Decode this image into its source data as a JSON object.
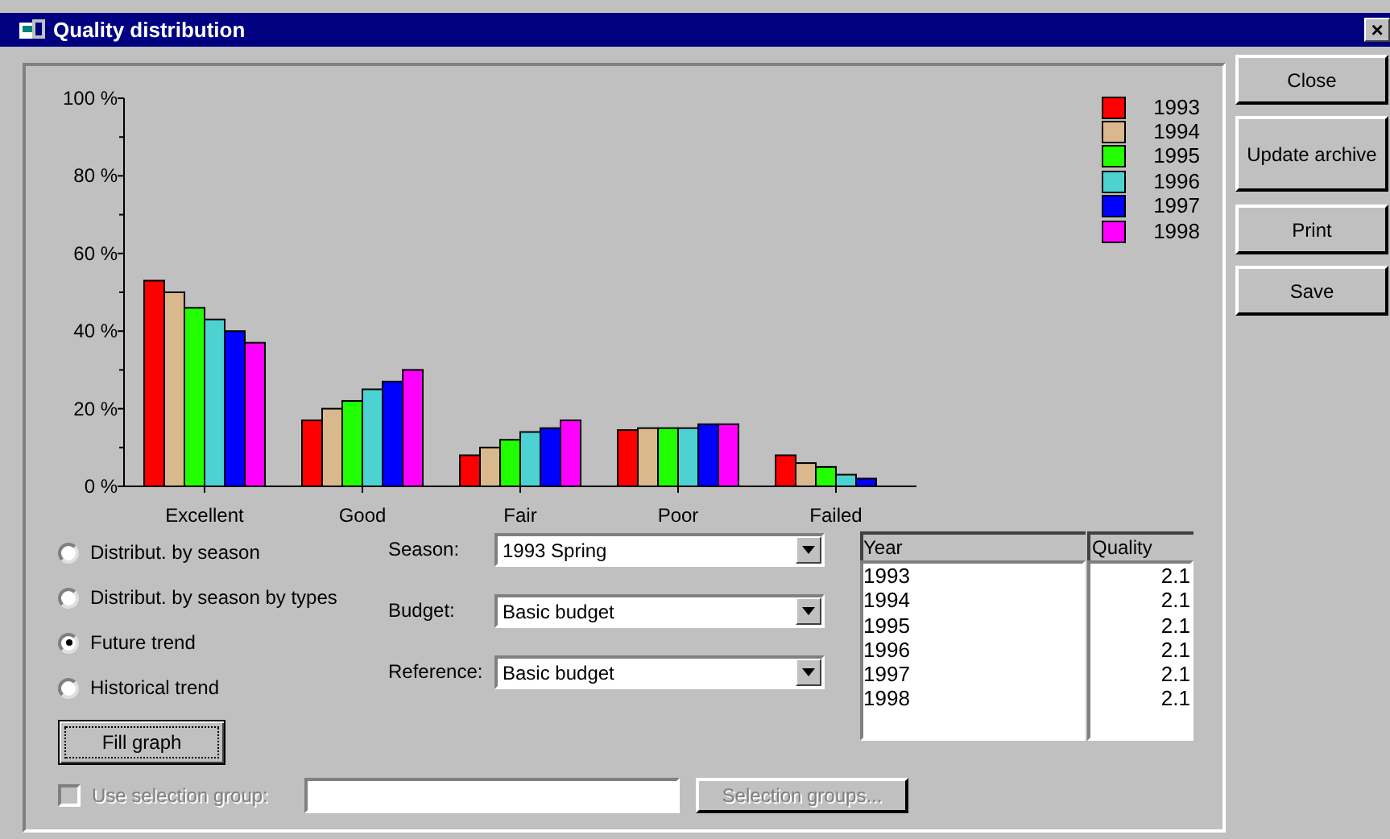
{
  "window": {
    "title": "Quality distribution",
    "close": "×"
  },
  "chart": {
    "chart_data": {
      "type": "bar",
      "legend": "right",
      "categories": [
        "Excellent",
        "Good",
        "Fair",
        "Poor",
        "Failed"
      ],
      "ylim": [
        0,
        100
      ],
      "yticks": [
        {
          "value": 0,
          "label": "0 %"
        },
        {
          "value": 20,
          "label": "20 %"
        },
        {
          "value": 40,
          "label": "40 %"
        },
        {
          "value": 60,
          "label": "60 %"
        },
        {
          "value": 80,
          "label": "80 %"
        },
        {
          "value": 100,
          "label": "100 %"
        }
      ],
      "series": [
        {
          "name": "1993",
          "color": "#ff0000",
          "values": [
            53,
            17,
            8,
            14.5,
            8
          ]
        },
        {
          "name": "1994",
          "color": "#d8b88c",
          "values": [
            50,
            20,
            10,
            15,
            6
          ]
        },
        {
          "name": "1995",
          "color": "#22ff00",
          "values": [
            46,
            22,
            12,
            15,
            5
          ]
        },
        {
          "name": "1996",
          "color": "#4cd2d0",
          "values": [
            43,
            25,
            14,
            15,
            3
          ]
        },
        {
          "name": "1997",
          "color": "#0000ff",
          "values": [
            40,
            27,
            15,
            16,
            2
          ]
        },
        {
          "name": "1998",
          "color": "#ff00ff",
          "values": [
            37,
            30,
            17,
            16,
            null
          ]
        }
      ]
    }
  },
  "modes": [
    {
      "label": "Distribut. by season",
      "selected": false
    },
    {
      "label": "Distribut. by season by types",
      "selected": false
    },
    {
      "label": "Future trend",
      "selected": true
    },
    {
      "label": "Historical trend",
      "selected": false
    }
  ],
  "fill_button": "Fill graph",
  "selectors": [
    {
      "label": "Season:",
      "value": "1993 Spring"
    },
    {
      "label": "Budget:",
      "value": "Basic budget"
    },
    {
      "label": "Reference:",
      "value": "Basic budget"
    }
  ],
  "table": {
    "columns": [
      "Year",
      "Quality"
    ],
    "rows": [
      [
        "1993",
        "2.1"
      ],
      [
        "1994",
        "2.1"
      ],
      [
        "1995",
        "2.1"
      ],
      [
        "1996",
        "2.1"
      ],
      [
        "1997",
        "2.1"
      ],
      [
        "1998",
        "2.1"
      ]
    ]
  },
  "selection_group": {
    "label": "Use selection group:",
    "checked": false,
    "disabled": true,
    "button": "Selection groups..."
  },
  "buttons": [
    "Close",
    "Update archive",
    "Print",
    "Save"
  ]
}
